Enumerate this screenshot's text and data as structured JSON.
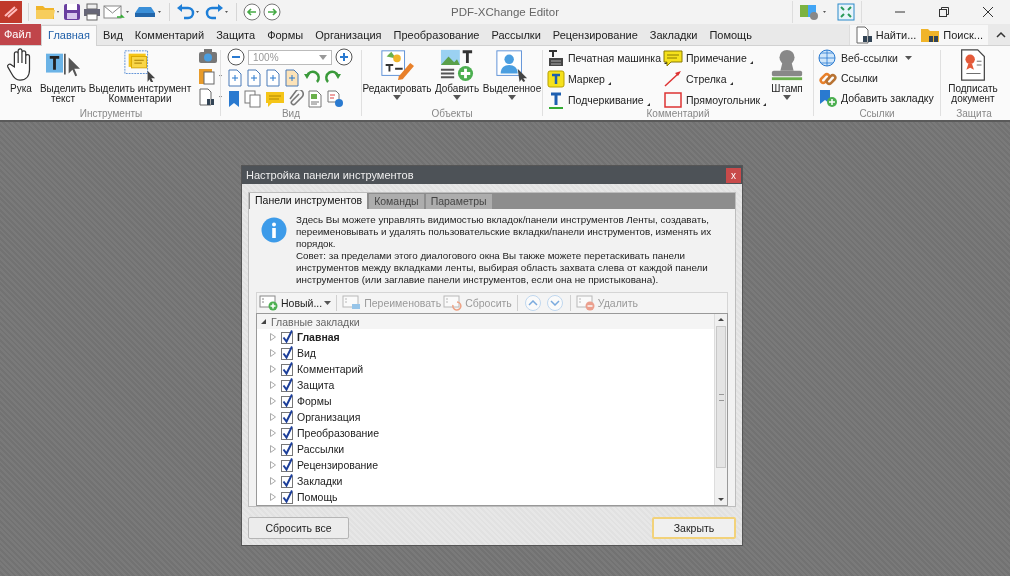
{
  "window": {
    "title": "PDF-XChange Editor"
  },
  "menu_tabs": [
    {
      "label": "Файл",
      "kind": "file",
      "selected": false
    },
    {
      "label": "Главная",
      "kind": "tab",
      "selected": true
    },
    {
      "label": "Вид",
      "kind": "tab",
      "selected": false
    },
    {
      "label": "Комментарий",
      "kind": "tab",
      "selected": false
    },
    {
      "label": "Защита",
      "kind": "tab",
      "selected": false
    },
    {
      "label": "Формы",
      "kind": "tab",
      "selected": false
    },
    {
      "label": "Организация",
      "kind": "tab",
      "selected": false
    },
    {
      "label": "Преобразование",
      "kind": "tab",
      "selected": false
    },
    {
      "label": "Рассылки",
      "kind": "tab",
      "selected": false
    },
    {
      "label": "Рецензирование",
      "kind": "tab",
      "selected": false
    },
    {
      "label": "Закладки",
      "kind": "tab",
      "selected": false
    },
    {
      "label": "Помощь",
      "kind": "tab",
      "selected": false
    }
  ],
  "search_buttons": [
    {
      "label": "Найти..."
    },
    {
      "label": "Поиск..."
    }
  ],
  "ribbon": {
    "groups": [
      {
        "label": "Инструменты",
        "buttons": [
          {
            "label": "Рука"
          },
          {
            "label": "Выделить текст"
          },
          {
            "label": "Выделить инструмент Комментарии"
          }
        ]
      },
      {
        "label": "Вид",
        "zoom": "100%"
      },
      {
        "label": "Объекты",
        "buttons": [
          {
            "label": "Редактировать"
          },
          {
            "label": "Добавить"
          },
          {
            "label": "Выделенное"
          }
        ]
      },
      {
        "label": "Комментарий",
        "buttons": [
          {
            "label": "Печатная машинка"
          },
          {
            "label": "Примечание"
          },
          {
            "label": "Маркер"
          },
          {
            "label": "Стрелка"
          },
          {
            "label": "Подчеркивание"
          },
          {
            "label": "Прямоугольник"
          },
          {
            "label": "Штамп"
          }
        ]
      },
      {
        "label": "Ссылки",
        "buttons": [
          {
            "label": "Веб-ссылки"
          },
          {
            "label": "Ссылки"
          },
          {
            "label": "Добавить закладку"
          }
        ]
      },
      {
        "label": "Защита",
        "buttons": [
          {
            "label": "Подписать документ"
          }
        ]
      }
    ]
  },
  "dialog": {
    "title": "Настройка панели инструментов",
    "close": "x",
    "tabs": [
      {
        "label": "Панели инструментов",
        "selected": true
      },
      {
        "label": "Команды",
        "selected": false
      },
      {
        "label": "Параметры",
        "selected": false
      }
    ],
    "info": [
      "Здесь Вы можете управлять видимостью вкладок/панели инструментов Ленты, создавать, переименовывать и удалять пользовательские вкладки/панели инструментов, изменять их порядок.",
      "Совет: за пределами этого диалогового окна Вы также можете перетаскивать панели инструментов между вкладками ленты, выбирая область захвата слева от каждой панели инструментов (или заглавие панели инструментов, если она не пристыкована)."
    ],
    "toolbar": [
      {
        "kind": "new",
        "label": "Новый...",
        "disabled": false
      },
      {
        "kind": "rename",
        "label": "Переименовать",
        "disabled": true
      },
      {
        "kind": "reset",
        "label": "Сбросить",
        "disabled": true
      },
      {
        "kind": "up",
        "disabled": true
      },
      {
        "kind": "down",
        "disabled": true
      },
      {
        "kind": "delete",
        "label": "Удалить",
        "disabled": true
      }
    ],
    "tree": {
      "label": "Главные закладки",
      "expanded": true,
      "children": [
        {
          "label": "Главная",
          "checked": true,
          "expanded": false,
          "current": true
        },
        {
          "label": "Вид",
          "checked": true,
          "expanded": false,
          "current": false
        },
        {
          "label": "Комментарий",
          "checked": true,
          "expanded": false,
          "current": false
        },
        {
          "label": "Защита",
          "checked": true,
          "expanded": false,
          "current": false
        },
        {
          "label": "Формы",
          "checked": true,
          "expanded": false,
          "current": false
        },
        {
          "label": "Организация",
          "checked": true,
          "expanded": false,
          "current": false
        },
        {
          "label": "Преобразование",
          "checked": true,
          "expanded": false,
          "current": false
        },
        {
          "label": "Рассылки",
          "checked": true,
          "expanded": false,
          "current": false
        },
        {
          "label": "Рецензирование",
          "checked": true,
          "expanded": false,
          "current": false
        },
        {
          "label": "Закладки",
          "checked": true,
          "expanded": false,
          "current": false
        },
        {
          "label": "Помощь",
          "checked": true,
          "expanded": false,
          "current": false
        }
      ]
    },
    "buttons": [
      {
        "label": "Сбросить все",
        "default": false
      },
      {
        "label": "Закрыть",
        "default": true
      }
    ]
  }
}
